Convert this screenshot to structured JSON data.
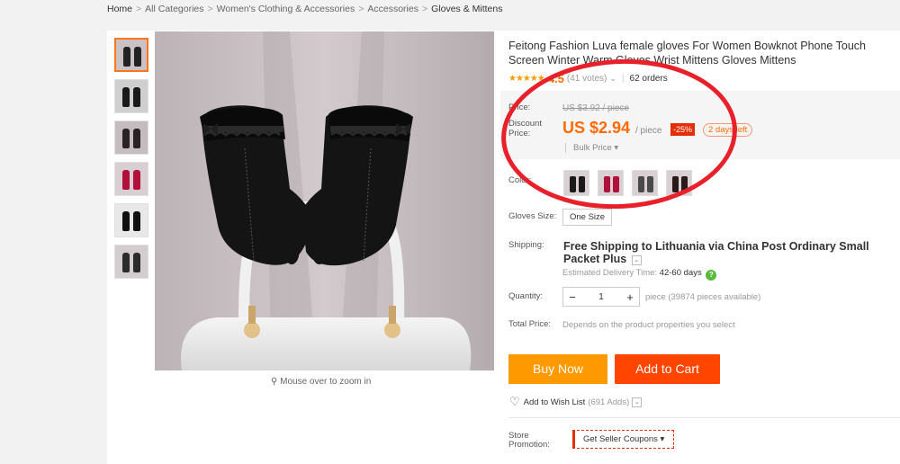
{
  "breadcrumb": {
    "items": [
      "Home",
      "All Categories",
      "Women's Clothing & Accessories",
      "Accessories",
      "Gloves & Mittens"
    ],
    "separator": ">"
  },
  "gallery": {
    "thumbnail_colors": [
      "#222222",
      "#1a1a1a",
      "#2a2224",
      "#b0103a",
      "#111111",
      "#2b2b2b"
    ],
    "zoom_hint": "Mouse over to zoom in"
  },
  "product": {
    "title": "Feitong Fashion Luva female gloves For Women Bowknot Phone Touch Screen Winter Warm Gloves Wrist Mittens Gloves Mittens",
    "rating": {
      "stars": "★★★★★",
      "value": "4.5",
      "votes": "(41 votes)",
      "orders": "62 orders"
    },
    "price": {
      "label": "Price:",
      "original": "US $3.92 / piece",
      "discount_label_1": "Discount",
      "discount_label_2": "Price:",
      "current": "US $2.94",
      "unit": "/ piece",
      "discount_badge": "-25%",
      "time_left": "2 days left",
      "bulk": "Bulk Price ▾"
    },
    "color": {
      "label": "Color:",
      "options": [
        "#1a1a1a",
        "#b0103a",
        "#4a4a4a",
        "#2a1a1a"
      ]
    },
    "size": {
      "label": "Gloves Size:",
      "value": "One Size"
    },
    "shipping": {
      "label": "Shipping:",
      "method": "Free Shipping to Lithuania via China Post Ordinary Small Packet Plus",
      "estimate_label": "Estimated Delivery Time:",
      "estimate_value": "42-60 days"
    },
    "quantity": {
      "label": "Quantity:",
      "value": "1",
      "available": "piece (39874 pieces available)"
    },
    "total": {
      "label": "Total Price:",
      "description": "Depends on the product properties you select"
    },
    "actions": {
      "buy_now": "Buy Now",
      "add_to_cart": "Add to Cart",
      "wishlist": "Add to Wish List",
      "wishlist_adds": "(691 Adds)"
    },
    "promotion": {
      "label_1": "Store",
      "label_2": "Promotion:",
      "coupon": "Get Seller Coupons ▾"
    }
  },
  "colors": {
    "accent_orange": "#ff6a00",
    "buy_now": "#ff9900",
    "add_to_cart": "#ff4500",
    "annotation_circle": "#e8202a"
  }
}
